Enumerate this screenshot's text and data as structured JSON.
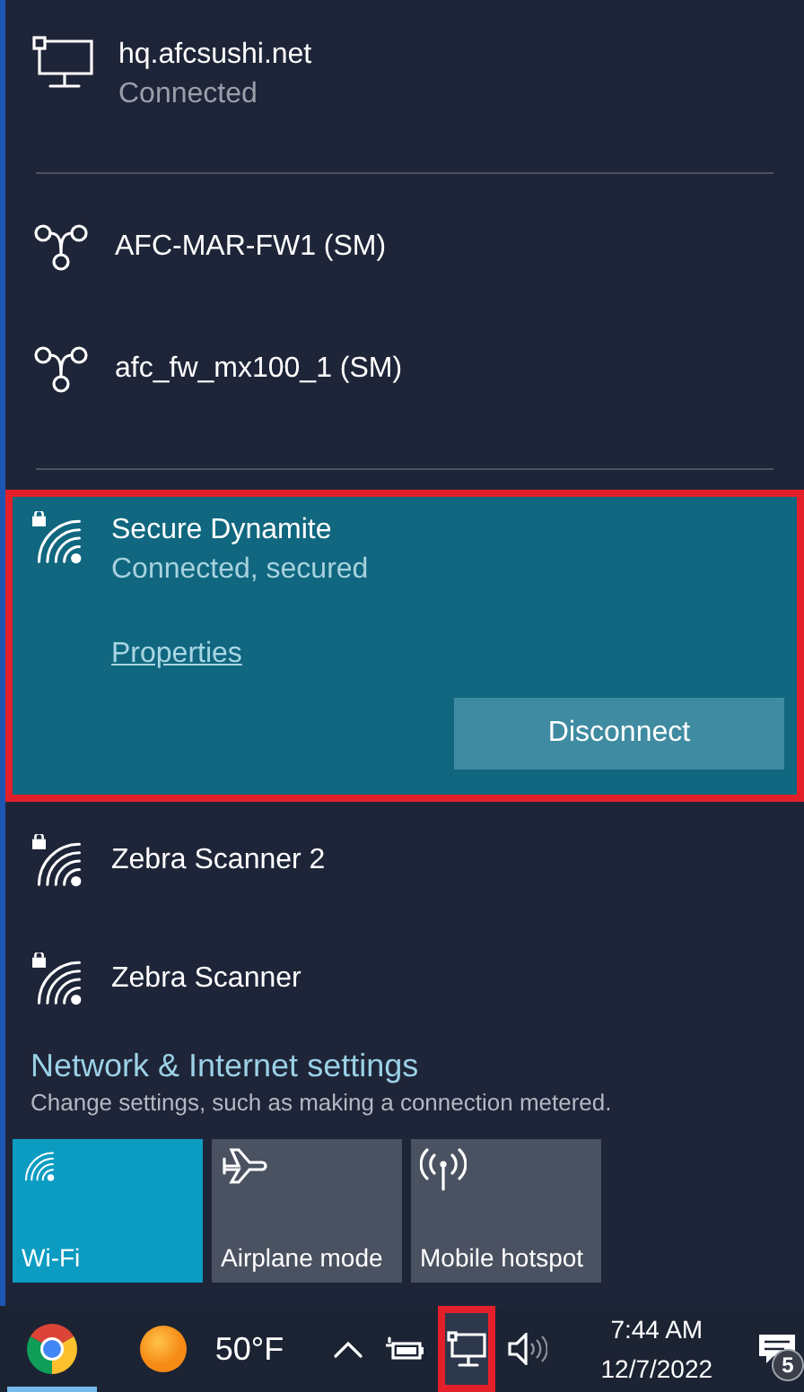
{
  "networks": [
    {
      "kind": "wired",
      "name": "hq.afcsushi.net",
      "status": "Connected",
      "selected": false
    },
    {
      "kind": "vpn",
      "name": "AFC-MAR-FW1 (SM)",
      "selected": false
    },
    {
      "kind": "vpn",
      "name": "afc_fw_mx100_1 (SM)",
      "selected": false
    },
    {
      "kind": "wifi",
      "name": "Secure Dynamite",
      "status": "Connected, secured",
      "secured": true,
      "selected": true,
      "outlined": true,
      "link": "Properties",
      "button": "Disconnect"
    },
    {
      "kind": "wifi",
      "name": "Zebra Scanner 2",
      "secured": true,
      "selected": false
    },
    {
      "kind": "wifi",
      "name": "Zebra Scanner",
      "secured": true,
      "selected": false
    }
  ],
  "settings": {
    "title": "Network & Internet settings",
    "subtitle": "Change settings, such as making a connection metered."
  },
  "tiles": [
    {
      "kind": "wifi",
      "label": "Wi-Fi",
      "on": true
    },
    {
      "kind": "airplane",
      "label": "Airplane mode",
      "on": false
    },
    {
      "kind": "hotspot",
      "label": "Mobile hotspot",
      "on": false
    }
  ],
  "taskbar": {
    "apps": [
      {
        "kind": "chrome",
        "running": true
      }
    ],
    "weather": {
      "temp": "50°F"
    },
    "tray": [
      {
        "kind": "chevron",
        "outlined": false
      },
      {
        "kind": "battery",
        "outlined": false
      },
      {
        "kind": "network",
        "outlined": true
      },
      {
        "kind": "volume",
        "outlined": false
      }
    ],
    "time": "7:44 AM",
    "date": "12/7/2022",
    "notifications": {
      "count": "5"
    }
  }
}
